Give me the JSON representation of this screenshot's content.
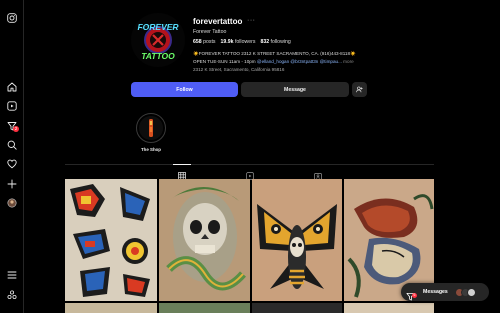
{
  "profile": {
    "username": "forevertattoo",
    "more_label": "···",
    "full_name": "Forever Tattoo",
    "stats": {
      "posts_count": "658",
      "posts_label": "posts",
      "followers_count": "19.9k",
      "followers_label": "followers",
      "following_count": "832",
      "following_label": "following"
    },
    "bio_line1": "☀️FOREVER TATTOO 2312 K STREET SACRAMENTO, CA. (916)443-8118☀️",
    "bio_line2_prefix": "OPEN TUE-SUN 11am - 10pm ",
    "bio_line2_links": "@elland_hogan @br3ntpatt3n @timpau...",
    "bio_line2_more": " more",
    "address": "2312 K Street, Sacramento, California 95816",
    "avatar_logo_text_top": "FOREVER",
    "avatar_logo_text_bottom": "TATTOO"
  },
  "actions": {
    "follow_label": "Follow",
    "message_label": "Message"
  },
  "highlights": [
    {
      "label": "The Shop"
    }
  ],
  "sidebar": {
    "notifications_badge": "2"
  },
  "messages_bar": {
    "label": "Messages",
    "badge": "6"
  },
  "colors": {
    "accent": "#4f5df5",
    "badge": "#ff3040",
    "link": "#8ab4f8",
    "background": "#000000",
    "button_secondary": "#262626"
  },
  "icons": {
    "sidebar": [
      "instagram-icon",
      "home-icon",
      "reels-icon",
      "notifications-icon",
      "search-icon",
      "heart-icon",
      "create-icon",
      "profile-avatar-icon",
      "menu-icon",
      "threads-icon"
    ],
    "tabs": [
      "grid-icon",
      "reels-tab-icon",
      "tagged-icon"
    ]
  }
}
